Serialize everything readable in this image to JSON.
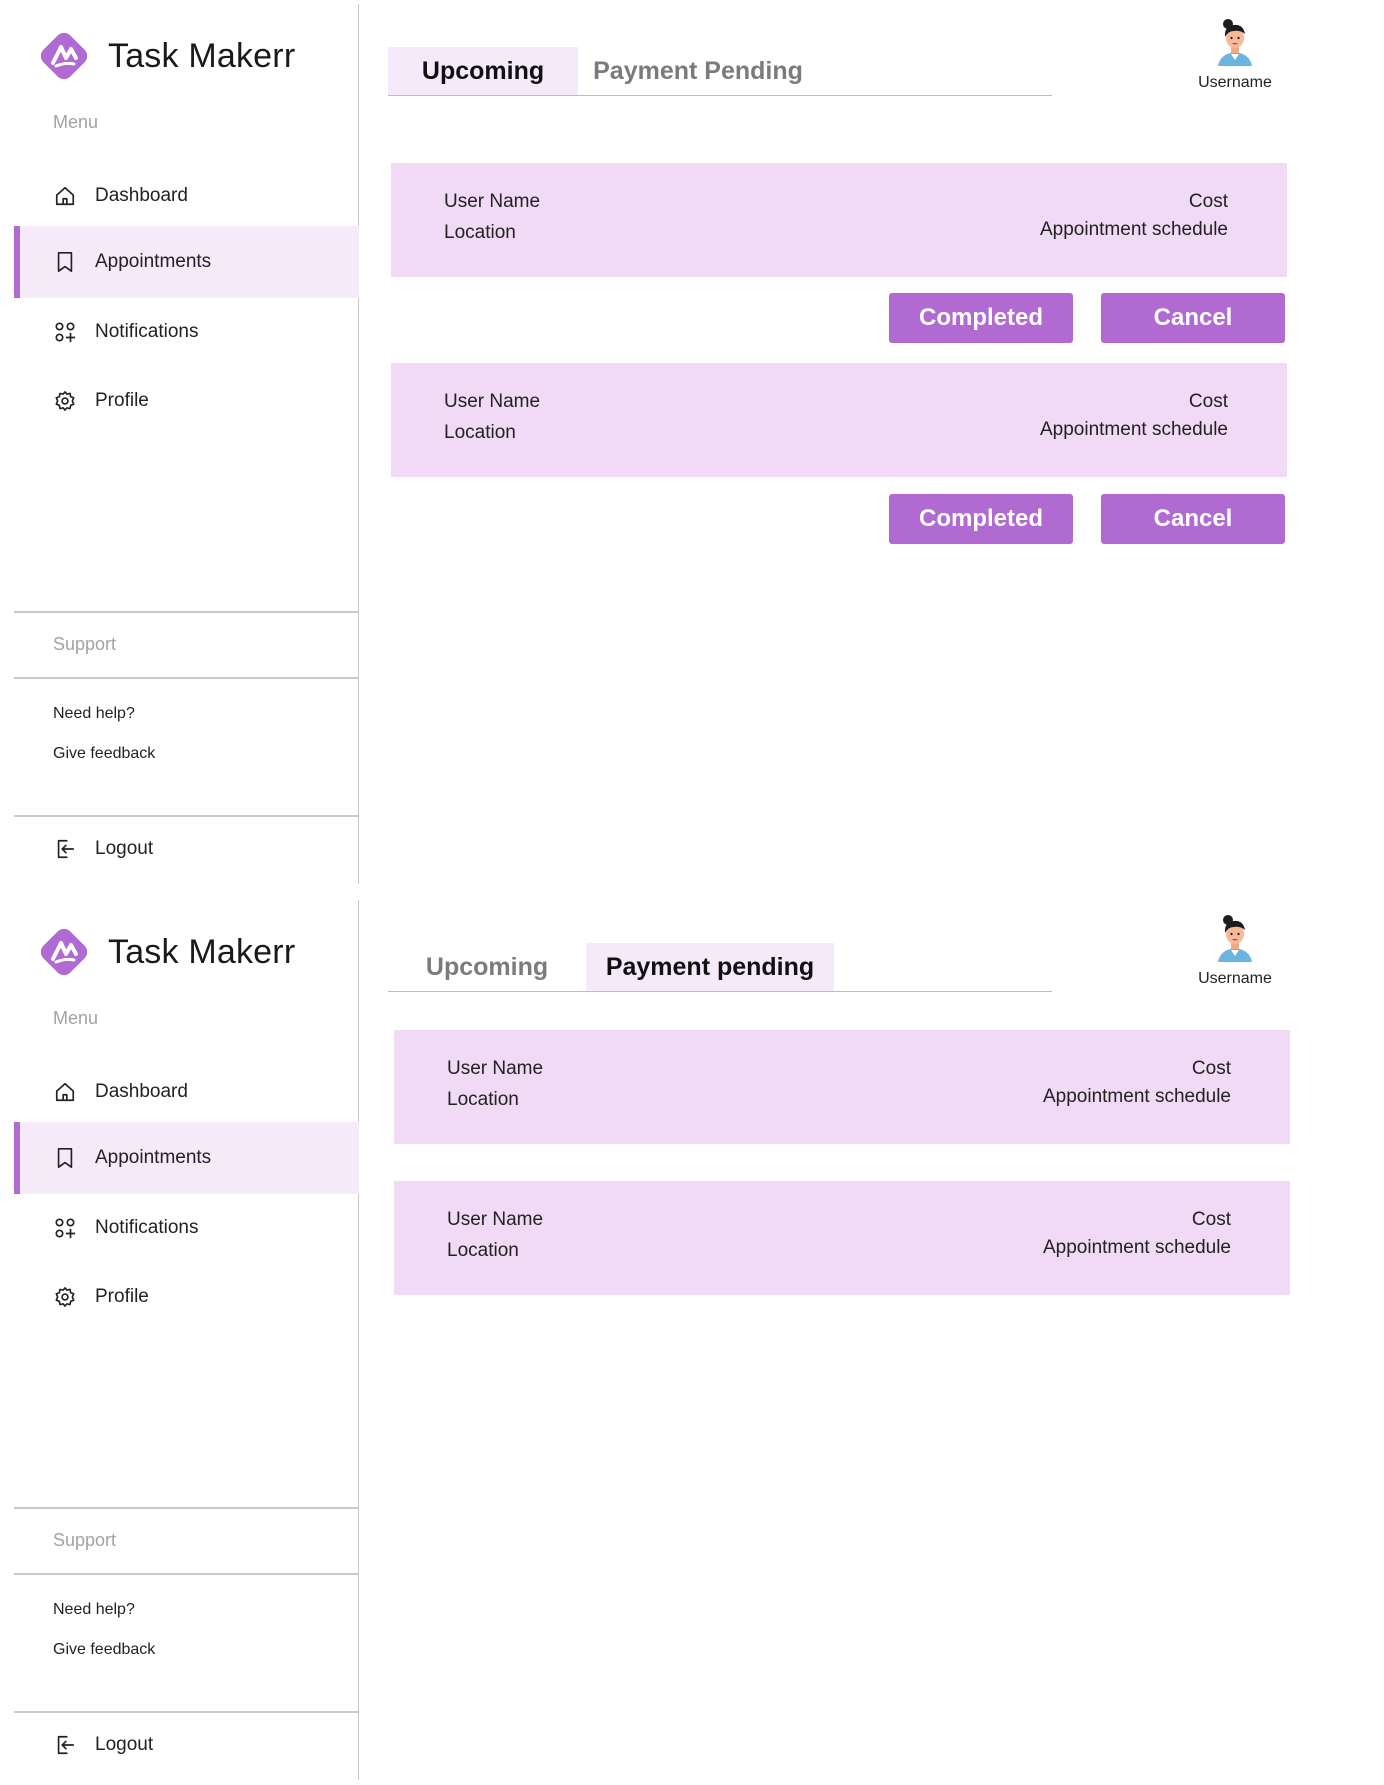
{
  "colors": {
    "accent": "#b06ad1",
    "accent_light": "#f4eafa",
    "card_bg": "#f0daf5",
    "muted_text": "#a3a3a3",
    "divider": "#c9c9c9"
  },
  "screens": [
    {
      "sidebar": {
        "brand": "Task Makerr",
        "menu_label": "Menu",
        "nav": [
          {
            "label": "Dashboard",
            "icon": "home-icon"
          },
          {
            "label": "Appointments",
            "icon": "bookmark-icon",
            "active": true
          },
          {
            "label": "Notifications",
            "icon": "grid-plus-icon"
          },
          {
            "label": "Profile",
            "icon": "gear-icon"
          }
        ],
        "support_label": "Support",
        "need_help": "Need help?",
        "give_feedback": "Give feedback",
        "logout": "Logout"
      },
      "tabs": [
        {
          "label": "Upcoming",
          "active": true
        },
        {
          "label": "Payment Pending",
          "active": false
        }
      ],
      "user": {
        "name": "Username"
      },
      "cards": [
        {
          "user": "User Name",
          "location": "Location",
          "cost": "Cost",
          "schedule": "Appointment schedule",
          "completed": "Completed",
          "cancel": "Cancel"
        },
        {
          "user": "User Name",
          "location": "Location",
          "cost": "Cost",
          "schedule": "Appointment schedule",
          "completed": "Completed",
          "cancel": "Cancel"
        }
      ]
    },
    {
      "sidebar": {
        "brand": "Task Makerr",
        "menu_label": "Menu",
        "nav": [
          {
            "label": "Dashboard",
            "icon": "home-icon"
          },
          {
            "label": "Appointments",
            "icon": "bookmark-icon",
            "active": true
          },
          {
            "label": "Notifications",
            "icon": "grid-plus-icon"
          },
          {
            "label": "Profile",
            "icon": "gear-icon"
          }
        ],
        "support_label": "Support",
        "need_help": "Need help?",
        "give_feedback": "Give feedback",
        "logout": "Logout"
      },
      "tabs": [
        {
          "label": "Upcoming",
          "active": false
        },
        {
          "label": "Payment pending",
          "active": true
        }
      ],
      "user": {
        "name": "Username"
      },
      "cards": [
        {
          "user": "User Name",
          "location": "Location",
          "cost": "Cost",
          "schedule": "Appointment schedule"
        },
        {
          "user": "User Name",
          "location": "Location",
          "cost": "Cost",
          "schedule": "Appointment schedule"
        }
      ]
    }
  ]
}
